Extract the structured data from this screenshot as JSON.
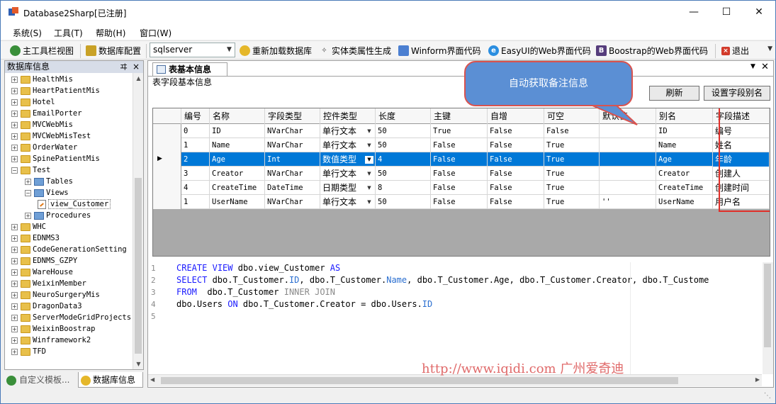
{
  "window": {
    "title": "Database2Sharp[已注册]"
  },
  "menu": [
    "系统(S)",
    "工具(T)",
    "帮助(H)",
    "窗口(W)"
  ],
  "toolbar": {
    "main_toolbar_view": "主工具栏视图",
    "db_config": "数据库配置",
    "db_type": "sqlserver",
    "reload_db": "重新加载数据库",
    "entity_attr": "实体类属性生成",
    "winform_code": "Winform界面代码",
    "easyui_code": "EasyUI的Web界面代码",
    "bootstrap_code": "Boostrap的Web界面代码",
    "exit": "退出"
  },
  "left_panel": {
    "title": "数据库信息",
    "pin": "ヰ",
    "close": "×",
    "tree": [
      {
        "label": "HealthMis",
        "level": 1,
        "type": "db",
        "expanded": false
      },
      {
        "label": "HeartPatientMis",
        "level": 1,
        "type": "db",
        "expanded": false
      },
      {
        "label": "Hotel",
        "level": 1,
        "type": "db",
        "expanded": false
      },
      {
        "label": "EmailPorter",
        "level": 1,
        "type": "db",
        "expanded": false
      },
      {
        "label": "MVCWebMis",
        "level": 1,
        "type": "db",
        "expanded": false
      },
      {
        "label": "MVCWebMisTest",
        "level": 1,
        "type": "db",
        "expanded": false
      },
      {
        "label": "OrderWater",
        "level": 1,
        "type": "db",
        "expanded": false
      },
      {
        "label": "SpinePatientMis",
        "level": 1,
        "type": "db",
        "expanded": false
      },
      {
        "label": "Test",
        "level": 1,
        "type": "db",
        "expanded": true
      },
      {
        "label": "Tables",
        "level": 2,
        "type": "tables",
        "expanded": false
      },
      {
        "label": "Views",
        "level": 2,
        "type": "views",
        "expanded": true
      },
      {
        "label": "view_Customer",
        "level": 3,
        "type": "view",
        "expanded": null
      },
      {
        "label": "Procedures",
        "level": 2,
        "type": "procs",
        "expanded": false
      },
      {
        "label": "WHC",
        "level": 1,
        "type": "db",
        "expanded": false
      },
      {
        "label": "EDNMS3",
        "level": 1,
        "type": "db",
        "expanded": false
      },
      {
        "label": "CodeGenerationSetting",
        "level": 1,
        "type": "db",
        "expanded": false
      },
      {
        "label": "EDNMS_GZPY",
        "level": 1,
        "type": "db",
        "expanded": false
      },
      {
        "label": "WareHouse",
        "level": 1,
        "type": "db",
        "expanded": false
      },
      {
        "label": "WeixinMember",
        "level": 1,
        "type": "db",
        "expanded": false
      },
      {
        "label": "NeuroSurgeryMis",
        "level": 1,
        "type": "db",
        "expanded": false
      },
      {
        "label": "DragonData3",
        "level": 1,
        "type": "db",
        "expanded": false
      },
      {
        "label": "ServerModeGridProjects",
        "level": 1,
        "type": "db",
        "expanded": false
      },
      {
        "label": "WeixinBoostrap",
        "level": 1,
        "type": "db",
        "expanded": false
      },
      {
        "label": "Winframework2",
        "level": 1,
        "type": "db",
        "expanded": false
      },
      {
        "label": "TFD",
        "level": 1,
        "type": "db",
        "expanded": false
      }
    ],
    "bottom_tabs": [
      "自定义模板...",
      "数据库信息"
    ]
  },
  "doc": {
    "tab_title": "表基本信息",
    "group_label": "表字段基本信息",
    "refresh_button": "刷新",
    "set_alias_button": "设置字段别名",
    "callout": "自动获取备注信息",
    "columns": [
      "编号",
      "名称",
      "字段类型",
      "控件类型",
      "长度",
      "主键",
      "自增",
      "可空",
      "默认值",
      "别名",
      "字段描述"
    ],
    "rows": [
      [
        "0",
        "ID",
        "NVarChar",
        "单行文本",
        "50",
        "True",
        "False",
        "False",
        "",
        "ID",
        "编号"
      ],
      [
        "1",
        "Name",
        "NVarChar",
        "单行文本",
        "50",
        "False",
        "False",
        "True",
        "",
        "Name",
        "姓名"
      ],
      [
        "2",
        "Age",
        "Int",
        "数值类型",
        "4",
        "False",
        "False",
        "True",
        "",
        "Age",
        "年龄"
      ],
      [
        "3",
        "Creator",
        "NVarChar",
        "单行文本",
        "50",
        "False",
        "False",
        "True",
        "",
        "Creator",
        "创建人"
      ],
      [
        "4",
        "CreateTime",
        "DateTime",
        "日期类型",
        "8",
        "False",
        "False",
        "True",
        "",
        "CreateTime",
        "创建时间"
      ],
      [
        "1",
        "UserName",
        "NVarChar",
        "单行文本",
        "50",
        "False",
        "False",
        "True",
        "''",
        "UserName",
        "用户名"
      ]
    ],
    "selected_row": 2,
    "code_lines": [
      "CREATE VIEW dbo.view_Customer AS",
      "SELECT dbo.T_Customer.ID, dbo.T_Customer.Name, dbo.T_Customer.Age, dbo.T_Customer.Creator, dbo.T_Custome",
      "FROM  dbo.T_Customer INNER JOIN",
      "dbo.Users ON dbo.T_Customer.Creator = dbo.Users.ID",
      ""
    ],
    "line_numbers": [
      "1",
      "2",
      "3",
      "4",
      "5"
    ],
    "watermark": "http://www.iqidi.com 广州爱奇迪"
  },
  "colors": {
    "selection": "#0078d7",
    "highlight_border": "#e0302a",
    "callout_fill": "#5b8fd4",
    "keyword": "#1a1aff"
  }
}
